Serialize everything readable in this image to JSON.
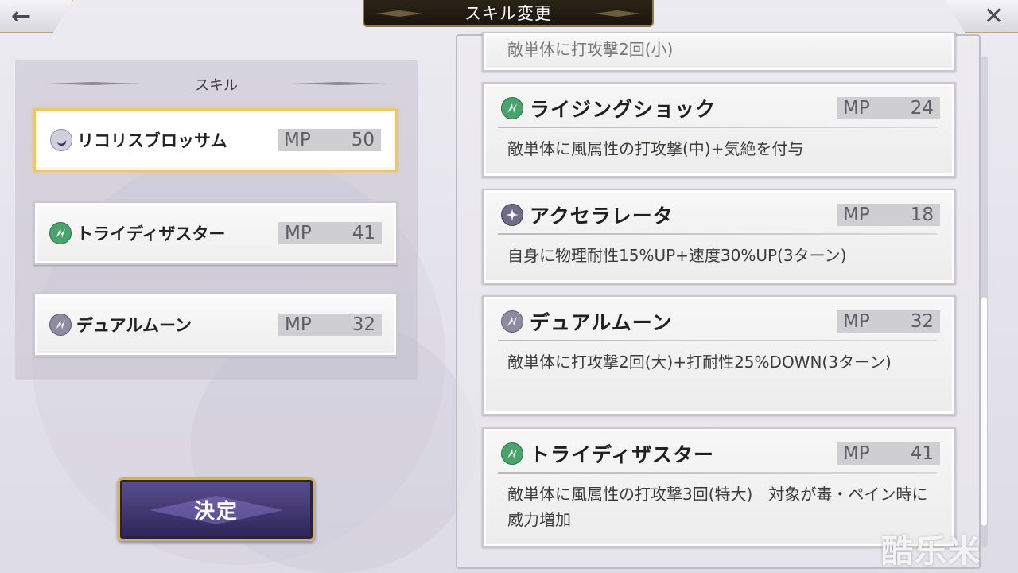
{
  "header": {
    "title": "スキル変更",
    "back_icon": "←",
    "close_icon": "✕"
  },
  "left_panel": {
    "heading": "スキル",
    "skills": [
      {
        "name": "リコリスブロッサム",
        "mp_label": "MP",
        "mp": "50",
        "icon": "moon-icon",
        "selected": true
      },
      {
        "name": "トライディザスター",
        "mp_label": "MP",
        "mp": "41",
        "icon": "wind-icon"
      },
      {
        "name": "デュアルムーン",
        "mp_label": "MP",
        "mp": "32",
        "icon": "strike-icon"
      }
    ]
  },
  "decide_button": {
    "label": "決定"
  },
  "skill_list": {
    "partial_top_text": "敵単体に打攻撃2回(小)",
    "items": [
      {
        "name": "ライジングショック",
        "mp_label": "MP",
        "mp": "24",
        "icon": "wind-icon",
        "desc": "敵単体に風属性の打攻撃(中)+気絶を付与"
      },
      {
        "name": "アクセラレータ",
        "mp_label": "MP",
        "mp": "18",
        "icon": "gear-icon",
        "desc": "自身に物理耐性15%UP+速度30%UP(3ターン)"
      },
      {
        "name": "デュアルムーン",
        "mp_label": "MP",
        "mp": "32",
        "icon": "strike-icon",
        "desc": "敵単体に打攻撃2回(大)+打耐性25%DOWN(3ターン)"
      },
      {
        "name": "トライディザスター",
        "mp_label": "MP",
        "mp": "41",
        "icon": "wind-icon",
        "desc": "敵単体に風属性の打攻撃3回(特大)　対象が毒・ペイン時に威力増加"
      }
    ]
  },
  "watermark": "酷乐米",
  "colors": {
    "gold_border": "#e8c86b",
    "button_purple": "#3b3270",
    "wind_green": "#3f9a62"
  }
}
